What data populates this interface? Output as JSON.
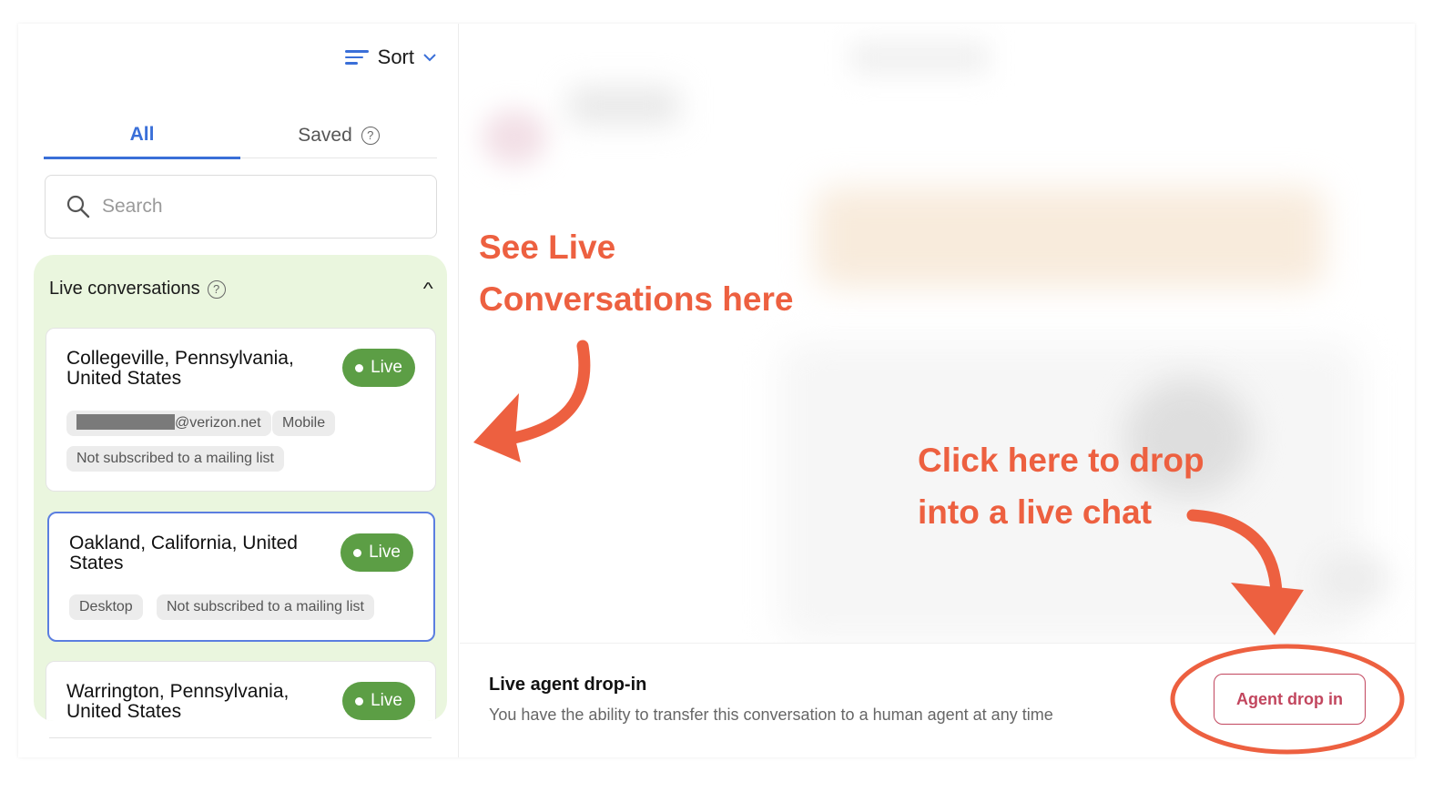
{
  "sort": {
    "label": "Sort",
    "icon": "sort-lines-icon"
  },
  "tabs": [
    {
      "label": "All",
      "active": true
    },
    {
      "label": "Saved",
      "active": false,
      "help_icon": "?"
    }
  ],
  "search": {
    "placeholder": "Search",
    "value": ""
  },
  "live_section": {
    "title": "Live conversations",
    "help_icon": "?",
    "collapse_icon": "^",
    "cards": [
      {
        "location": "Collegeville, Pennsylvania, United States",
        "badge": "Live",
        "email_suffix": "@verizon.net",
        "tags": [
          "Mobile",
          "Not subscribed to a mailing list"
        ]
      },
      {
        "location": "Oakland, California, United States",
        "badge": "Live",
        "tags": [
          "Desktop",
          "Not subscribed to a mailing list"
        ]
      },
      {
        "location": "Warrington, Pennsylvania, United States",
        "badge": "Live"
      }
    ]
  },
  "drop_in": {
    "title": "Live agent drop-in",
    "description": "You have the ability to transfer this conversation to a human agent at any time",
    "button_label": "Agent drop in"
  },
  "annotations": {
    "left_line1": "See Live",
    "left_line2": "Conversations here",
    "right_line1": "Click here to drop",
    "right_line2": "into a live chat",
    "color": "#ed6040"
  },
  "colors": {
    "accent_blue": "#3a6fd8",
    "live_green": "#5c9e45",
    "live_panel_bg": "#eaf6de",
    "drop_button": "#c2465e"
  }
}
